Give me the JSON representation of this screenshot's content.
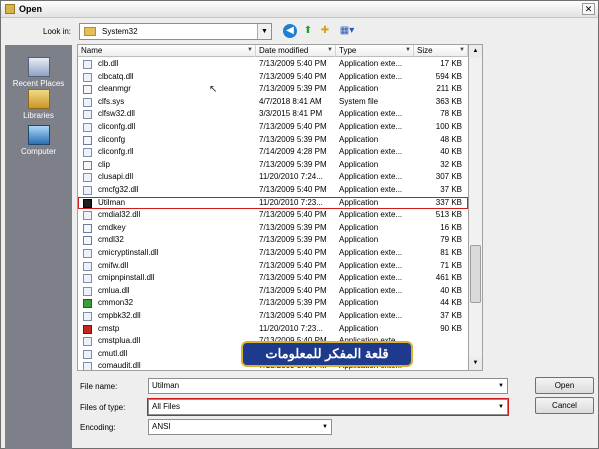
{
  "window": {
    "title": "Open",
    "close_glyph": "✕"
  },
  "toolbar": {
    "look_in_label": "Look in:",
    "look_in_value": "System32"
  },
  "places": [
    {
      "label": "Recent Places"
    },
    {
      "label": "Libraries"
    },
    {
      "label": "Computer"
    }
  ],
  "columns": {
    "name": "Name",
    "date": "Date modified",
    "type": "Type",
    "size": "Size"
  },
  "files": [
    {
      "name": "clb.dll",
      "date": "7/13/2009 5:40 PM",
      "type": "Application exte...",
      "size": "17 KB",
      "icon": "dll-icon"
    },
    {
      "name": "clbcatq.dll",
      "date": "7/13/2009 5:40 PM",
      "type": "Application exte...",
      "size": "594 KB",
      "icon": "dll-icon"
    },
    {
      "name": "cleanmgr",
      "date": "7/13/2009 5:39 PM",
      "type": "Application",
      "size": "211 KB",
      "icon": "exe-icon"
    },
    {
      "name": "clfs.sys",
      "date": "4/7/2018 8:41 AM",
      "type": "System file",
      "size": "363 KB",
      "icon": "sys-icon"
    },
    {
      "name": "clfsw32.dll",
      "date": "3/3/2015 8:41 PM",
      "type": "Application exte...",
      "size": "78 KB",
      "icon": "dll-icon"
    },
    {
      "name": "cliconfg.dll",
      "date": "7/13/2009 5:40 PM",
      "type": "Application exte...",
      "size": "100 KB",
      "icon": "dll-icon"
    },
    {
      "name": "cliconfg",
      "date": "7/13/2009 5:39 PM",
      "type": "Application",
      "size": "48 KB",
      "icon": "exe-icon"
    },
    {
      "name": "cliconfg.rll",
      "date": "7/14/2009 4:28 PM",
      "type": "Application exte...",
      "size": "40 KB",
      "icon": "dll-icon"
    },
    {
      "name": "clip",
      "date": "7/13/2009 5:39 PM",
      "type": "Application",
      "size": "32 KB",
      "icon": "exe-icon"
    },
    {
      "name": "clusapi.dll",
      "date": "11/20/2010 7:24...",
      "type": "Application exte...",
      "size": "307 KB",
      "icon": "dll-icon"
    },
    {
      "name": "cmcfg32.dll",
      "date": "7/13/2009 5:40 PM",
      "type": "Application exte...",
      "size": "37 KB",
      "icon": "dll-icon"
    },
    {
      "name": "Utilman",
      "date": "11/20/2010 7:23...",
      "type": "Application",
      "size": "337 KB",
      "icon": "console-icon",
      "selected": true
    },
    {
      "name": "cmdial32.dll",
      "date": "7/13/2009 5:40 PM",
      "type": "Application exte...",
      "size": "513 KB",
      "icon": "dll-icon"
    },
    {
      "name": "cmdkey",
      "date": "7/13/2009 5:39 PM",
      "type": "Application",
      "size": "16 KB",
      "icon": "exe-icon"
    },
    {
      "name": "cmdl32",
      "date": "7/13/2009 5:39 PM",
      "type": "Application",
      "size": "79 KB",
      "icon": "exe-icon"
    },
    {
      "name": "cmicryptinstall.dll",
      "date": "7/13/2009 5:40 PM",
      "type": "Application exte...",
      "size": "81 KB",
      "icon": "dll-icon"
    },
    {
      "name": "cmifw.dll",
      "date": "7/13/2009 5:40 PM",
      "type": "Application exte...",
      "size": "71 KB",
      "icon": "dll-icon"
    },
    {
      "name": "cmipnpinstall.dll",
      "date": "7/13/2009 5:40 PM",
      "type": "Application exte...",
      "size": "461 KB",
      "icon": "dll-icon"
    },
    {
      "name": "cmlua.dll",
      "date": "7/13/2009 5:40 PM",
      "type": "Application exte...",
      "size": "40 KB",
      "icon": "dll-icon"
    },
    {
      "name": "cmmon32",
      "date": "7/13/2009 5:39 PM",
      "type": "Application",
      "size": "44 KB",
      "icon": "cmmon-icon"
    },
    {
      "name": "cmpbk32.dll",
      "date": "7/13/2009 5:40 PM",
      "type": "Application exte...",
      "size": "37 KB",
      "icon": "dll-icon"
    },
    {
      "name": "cmstp",
      "date": "11/20/2010 7:23...",
      "type": "Application",
      "size": "90 KB",
      "icon": "cmstp-icon"
    },
    {
      "name": "cmstplua.dll",
      "date": "7/13/2009 5:40 PM",
      "type": "Application exte...",
      "size": "",
      "icon": "dll-icon"
    },
    {
      "name": "cmutl.dll",
      "date": "7/13/2009 5:40 PM",
      "type": "Application exte...",
      "size": "",
      "icon": "dll-icon"
    },
    {
      "name": "comaudit.dll",
      "date": "7/13/2009 5:40 PM",
      "type": "Application exte...",
      "size": "",
      "icon": "dll-icon"
    }
  ],
  "banner": {
    "text": "قلعة المفكر للمعلومات"
  },
  "form": {
    "file_name_label": "File name:",
    "file_name_value": "Utilman",
    "file_type_label": "Files of type:",
    "file_type_value": "All Files",
    "encoding_label": "Encoding:",
    "encoding_value": "ANSI"
  },
  "buttons": {
    "open": "Open",
    "cancel": "Cancel"
  }
}
